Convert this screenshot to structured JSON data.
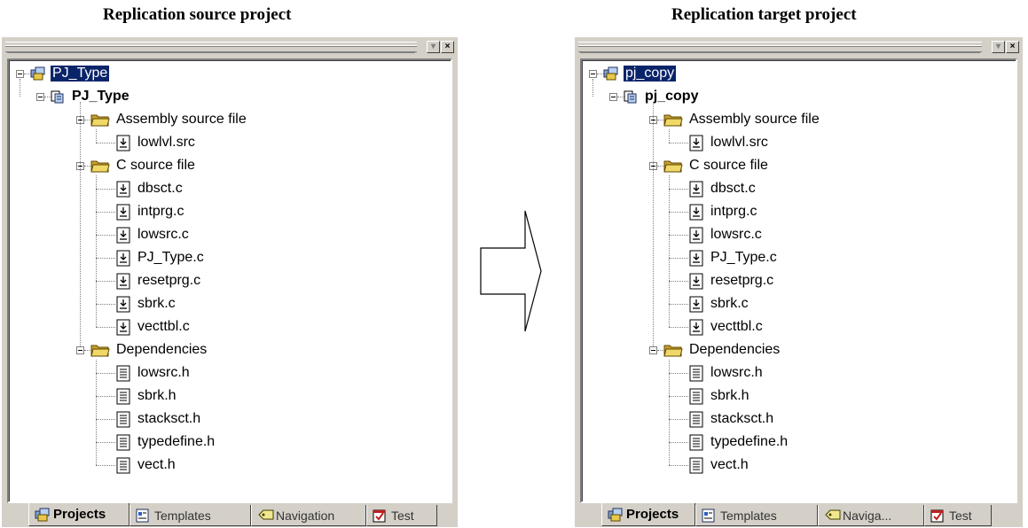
{
  "left": {
    "caption": "Replication source project",
    "selected_root": "PJ_Type",
    "project": "PJ_Type",
    "folders": [
      {
        "name": "Assembly source file",
        "files": [
          "lowlvl.src"
        ]
      },
      {
        "name": "C source file",
        "files": [
          "dbsct.c",
          "intprg.c",
          "lowsrc.c",
          "PJ_Type.c",
          "resetprg.c",
          "sbrk.c",
          "vecttbl.c"
        ]
      },
      {
        "name": "Dependencies",
        "files": [
          "lowsrc.h",
          "sbrk.h",
          "stacksct.h",
          "typedefine.h",
          "vect.h"
        ]
      }
    ],
    "tabs": [
      "Projects",
      "Templates",
      "Navigation",
      "Test"
    ]
  },
  "right": {
    "caption": "Replication target project",
    "selected_root": "pj_copy",
    "project": "pj_copy",
    "folders": [
      {
        "name": "Assembly source file",
        "files": [
          "lowlvl.src"
        ]
      },
      {
        "name": "C source file",
        "files": [
          "dbsct.c",
          "intprg.c",
          "lowsrc.c",
          "PJ_Type.c",
          "resetprg.c",
          "sbrk.c",
          "vecttbl.c"
        ]
      },
      {
        "name": "Dependencies",
        "files": [
          "lowsrc.h",
          "sbrk.h",
          "stacksct.h",
          "typedefine.h",
          "vect.h"
        ]
      }
    ],
    "tabs": [
      "Projects",
      "Templates",
      "Naviga...",
      "Test"
    ]
  },
  "icons": {
    "workspace": "workspace-icon",
    "project": "project-icon",
    "folder": "folder-icon",
    "source_file": "source-file-icon",
    "header_file": "header-file-icon",
    "arrow": "right-arrow-icon"
  },
  "colors": {
    "selection": "#0a246a",
    "panel": "#d4d0c8",
    "folder": "#e8c84a"
  }
}
